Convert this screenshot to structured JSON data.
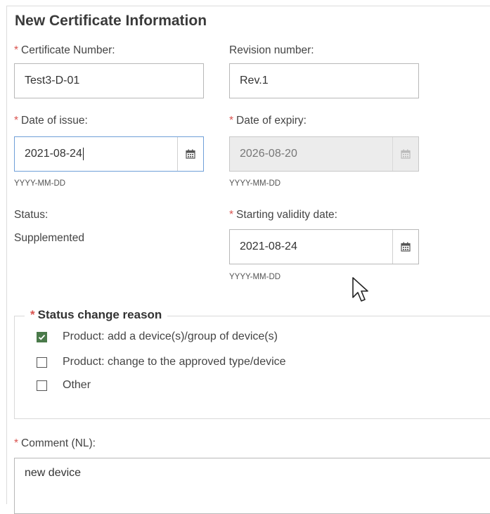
{
  "form": {
    "title": "New Certificate Information",
    "required_marker": "*",
    "certificate_number": {
      "label": "Certificate Number:",
      "value": "Test3-D-01",
      "required": true
    },
    "revision_number": {
      "label": "Revision number:",
      "value": "Rev.1",
      "required": false
    },
    "date_of_issue": {
      "label": "Date of issue:",
      "value": "2021-08-24",
      "hint": "YYYY-MM-DD",
      "required": true,
      "state": "focused"
    },
    "date_of_expiry": {
      "label": "Date of expiry:",
      "value": "2026-08-20",
      "hint": "YYYY-MM-DD",
      "required": true,
      "state": "disabled"
    },
    "status": {
      "label": "Status:",
      "value": "Supplemented"
    },
    "starting_validity_date": {
      "label": "Starting validity date:",
      "value": "2021-08-24",
      "hint": "YYYY-MM-DD",
      "required": true
    },
    "status_change_reason": {
      "legend": "Status change reason",
      "options": [
        {
          "label": "Product: add a device(s)/group of device(s)",
          "checked": true
        },
        {
          "label": "Product: change to the approved type/device",
          "checked": false
        },
        {
          "label": "Other",
          "checked": false
        }
      ]
    },
    "comment": {
      "label": "Comment (NL):",
      "value": "new device"
    }
  },
  "icons": {
    "calendar": "calendar-icon",
    "check": "check-icon",
    "cursor": "mouse-pointer-icon"
  },
  "colors": {
    "required": "#d9534f",
    "focus_border": "#6f9fd8",
    "checkbox_checked": "#4a7a4a",
    "disabled_bg": "#ececec"
  }
}
